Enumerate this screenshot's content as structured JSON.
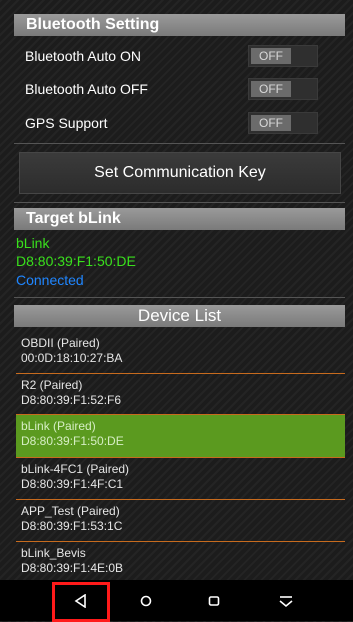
{
  "bluetooth": {
    "header": "Bluetooth Setting",
    "settings": [
      {
        "label": "Bluetooth Auto ON",
        "value": "OFF"
      },
      {
        "label": "Bluetooth Auto OFF",
        "value": "OFF"
      },
      {
        "label": "GPS Support",
        "value": "OFF"
      }
    ]
  },
  "comm_key_button": "Set Communication Key",
  "target": {
    "header": "Target bLink",
    "name": "bLink",
    "mac": "D8:80:39:F1:50:DE",
    "status": "Connected",
    "name_color": "#39e01c",
    "status_color": "#1f86ff"
  },
  "device_list": {
    "header": "Device List",
    "items": [
      {
        "name": "OBDII (Paired)",
        "mac": "00:0D:18:10:27:BA",
        "selected": false
      },
      {
        "name": "R2 (Paired)",
        "mac": "D8:80:39:F1:52:F6",
        "selected": false
      },
      {
        "name": "bLink (Paired)",
        "mac": "D8:80:39:F1:50:DE",
        "selected": true
      },
      {
        "name": "bLink-4FC1 (Paired)",
        "mac": "D8:80:39:F1:4F:C1",
        "selected": false
      },
      {
        "name": "APP_Test (Paired)",
        "mac": "D8:80:39:F1:53:1C",
        "selected": false
      },
      {
        "name": "bLink_Bevis",
        "mac": "D8:80:39:F1:4E:0B",
        "selected": false
      }
    ],
    "selected_color": "#5b9a1f",
    "separator_color": "#c76b1e"
  },
  "navbar": {
    "buttons": [
      "back-icon",
      "home-icon",
      "recents-icon",
      "dropdown-icon"
    ],
    "highlight_color": "#ff1a1a"
  }
}
